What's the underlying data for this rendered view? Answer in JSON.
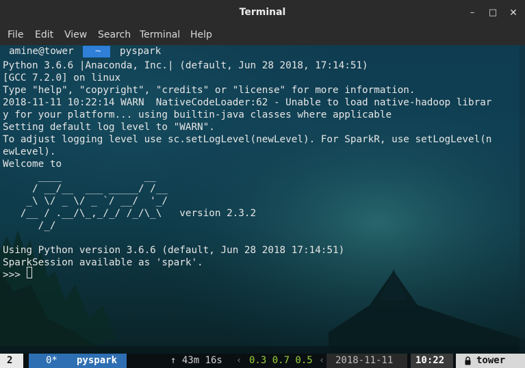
{
  "window": {
    "title": "Terminal",
    "minimize_icon": "minimize-icon",
    "maximize_icon": "maximize-icon",
    "close_icon": "close-icon",
    "minimize_glyph": "–",
    "maximize_glyph": "□",
    "close_glyph": "✕"
  },
  "menu": {
    "file": "File",
    "edit": "Edit",
    "view": "View",
    "search": "Search",
    "terminal": "Terminal",
    "help": "Help"
  },
  "prompt": {
    "user_host": "amine@tower",
    "directory": "~",
    "command": "pyspark"
  },
  "output": {
    "lines": [
      "Python 3.6.6 |Anaconda, Inc.| (default, Jun 28 2018, 17:14:51)",
      "[GCC 7.2.0] on linux",
      "Type \"help\", \"copyright\", \"credits\" or \"license\" for more information.",
      "2018-11-11 10:22:14 WARN  NativeCodeLoader:62 - Unable to load native-hadoop librar",
      "y for your platform... using builtin-java classes where applicable",
      "Setting default log level to \"WARN\".",
      "To adjust logging level use sc.setLogLevel(newLevel). For SparkR, use setLogLevel(n",
      "ewLevel).",
      "Welcome to",
      "      ____              __",
      "     / __/__  ___ _____/ /__",
      "    _\\ \\/ _ \\/ _ `/ __/  '_/",
      "   /__ / .__/\\_,_/_/ /_/\\_\\   version 2.3.2",
      "      /_/",
      "",
      "Using Python version 3.6.6 (default, Jun 28 2018 17:14:51)",
      "SparkSession available as 'spark'.",
      ">>> "
    ]
  },
  "statusbar": {
    "session": "2",
    "window_index": "0*",
    "window_name": "pyspark",
    "uptime": "↑ 43m 16s",
    "load": "0.3 0.7 0.5",
    "date": "2018-11-11",
    "time": "10:22",
    "host": "tower",
    "lock_icon": "lock-icon"
  },
  "colors": {
    "titlebar": "#2b2b2b",
    "terminal_text": "#e6e6e6",
    "prompt_dir_bg": "#2f7fd8",
    "status_window_bg": "#2e6fb3",
    "status_load": "#9bd13a"
  }
}
